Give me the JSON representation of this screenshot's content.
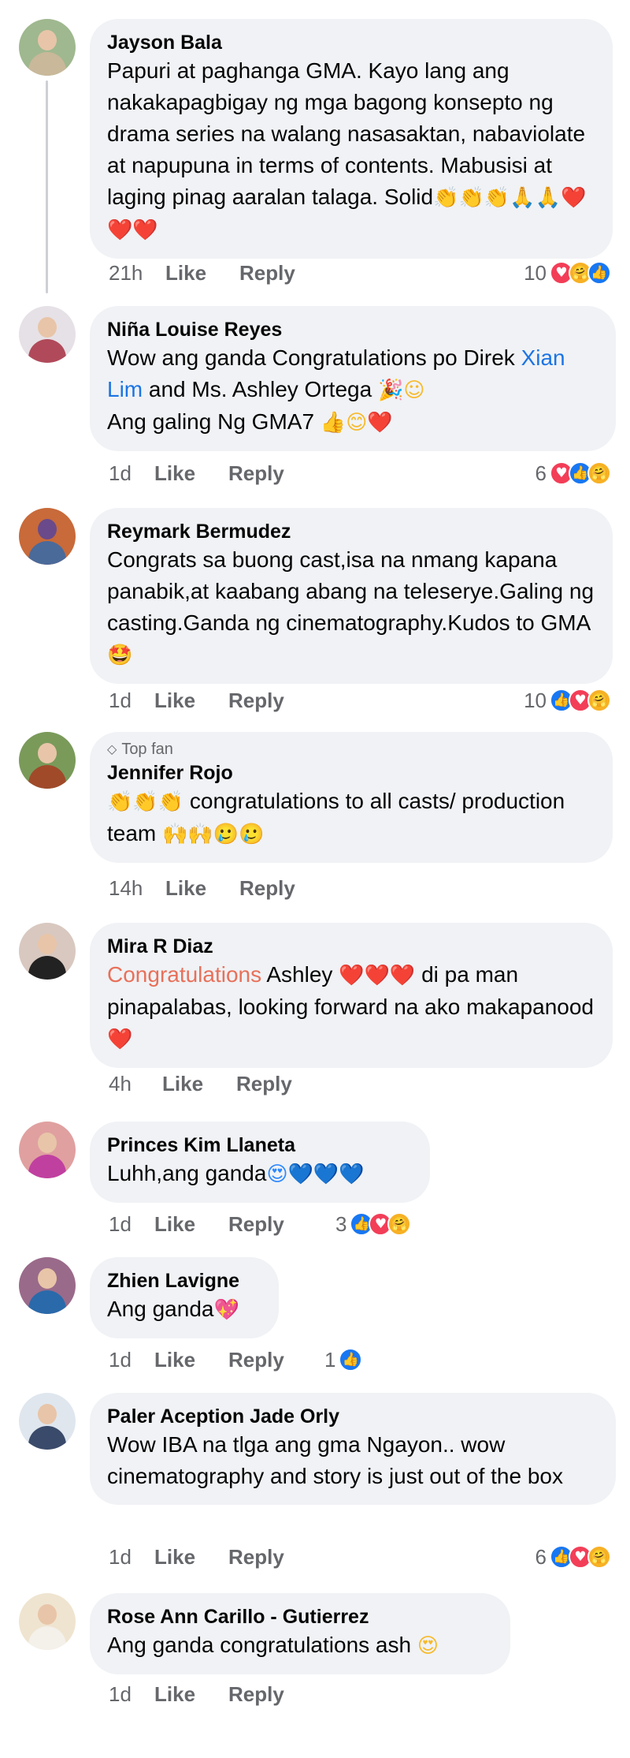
{
  "comments": [
    {
      "name": "Jayson Bala",
      "text": "Papuri at paghanga GMA. Kayo lang ang nakakapagbigay ng mga bagong konsepto ng drama series na walang nasasaktan, nabaviolate at napupuna in terms of contents. Mabusisi at laging pinag aaralan talaga. Solid",
      "emoji": "👏👏👏🙏🙏❤️❤️❤️",
      "time": "21h",
      "like": "Like",
      "reply": "Reply",
      "reaction_count": "10",
      "reactions": [
        "love",
        "care",
        "like"
      ]
    },
    {
      "name": "Niña Louise Reyes",
      "text_before": "Wow ang ganda Congratulations po Direk ",
      "link": "Xian Lim",
      "text_after": " and Ms. Ashley Ortega",
      "emoji": "🎉☺",
      "line2": "Ang galing Ng GMA7",
      "emoji2": "👍😊❤️",
      "time": "1d",
      "like": "Like",
      "reply": "Reply",
      "reaction_count": "6",
      "reactions": [
        "love",
        "like",
        "care"
      ]
    },
    {
      "name": "Reymark Bermudez",
      "text": "Congrats sa buong cast,isa na nmang kapana panabik,at kaabang abang na teleserye.Galing ng casting.Ganda ng cinematography.Kudos to GMA",
      "emoji": "🤩",
      "time": "1d",
      "like": "Like",
      "reply": "Reply",
      "reaction_count": "10",
      "reactions": [
        "like",
        "love",
        "care"
      ]
    },
    {
      "badge": "Top fan",
      "name": "Jennifer Rojo",
      "emoji_before": "👏👏👏",
      "text": " congratulations to all casts/ production team ",
      "emoji": "🙌🙌🥲🥲",
      "time": "14h",
      "like": "Like",
      "reply": "Reply"
    },
    {
      "name": "Mira R Diaz",
      "highlight": "Congratulations",
      "text_before": " Ashley ",
      "emoji_mid": "❤️❤️❤️",
      "text_after": " di pa man pinapalabas, looking forward na ako makapanood ",
      "emoji": "❤️",
      "time": "4h",
      "like": "Like",
      "reply": "Reply"
    },
    {
      "name": "Princes Kim Llaneta",
      "text": "Luhh,ang ganda",
      "emoji": "😍💙💙💙",
      "time": "1d",
      "like": "Like",
      "reply": "Reply",
      "reaction_count": "3",
      "reactions": [
        "like",
        "love",
        "care"
      ]
    },
    {
      "name": "Zhien Lavigne",
      "text": "Ang ganda",
      "emoji": "💖",
      "time": "1d",
      "like": "Like",
      "reply": "Reply",
      "reaction_count": "1",
      "reactions": [
        "like"
      ]
    },
    {
      "name": "Paler Aception Jade Orly",
      "text": "Wow IBA na tlga ang gma Ngayon.. wow cinematography and story is just out of the box",
      "time": "1d",
      "like": "Like",
      "reply": "Reply",
      "reaction_count": "6",
      "reactions": [
        "like",
        "love",
        "care"
      ]
    },
    {
      "name": "Rose Ann Carillo - Gutierrez",
      "text": "Ang ganda congratulations ash ",
      "emoji": "😍",
      "time": "1d",
      "like": "Like",
      "reply": "Reply"
    }
  ],
  "reaction_icons": {
    "like": "👍",
    "love": "♥",
    "care": "🤗"
  },
  "colors": {
    "link": "#1b74e4",
    "highlight": "#e8705a",
    "bubble": "#f0f2f5",
    "meta": "#65676b"
  }
}
